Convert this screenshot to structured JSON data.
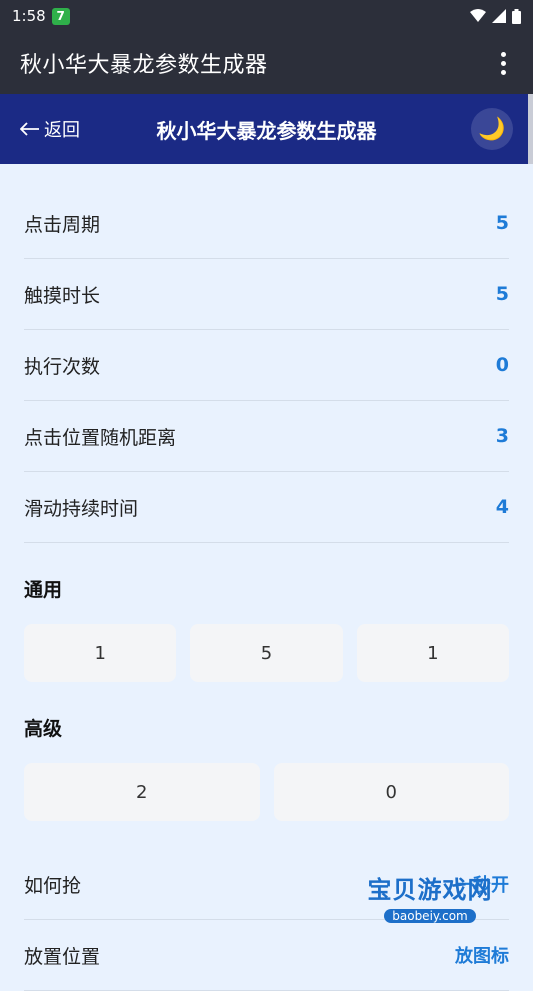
{
  "status_bar": {
    "time": "1:58",
    "notification_badge": "7"
  },
  "app_bar": {
    "title": "秋小华大暴龙参数生成器"
  },
  "page_header": {
    "back_label": "返回",
    "title": "秋小华大暴龙参数生成器",
    "theme_icon": "moon-icon"
  },
  "params": [
    {
      "label": "点击周期",
      "value": "5"
    },
    {
      "label": "触摸时长",
      "value": "5"
    },
    {
      "label": "执行次数",
      "value": "0"
    },
    {
      "label": "点击位置随机距离",
      "value": "3"
    },
    {
      "label": "滑动持续时间",
      "value": "4"
    }
  ],
  "general": {
    "title": "通用",
    "buttons": [
      "1",
      "5",
      "1"
    ]
  },
  "advanced": {
    "title": "高级",
    "buttons": [
      "2",
      "0"
    ]
  },
  "extra_rows": [
    {
      "label": "如何抢",
      "value": "一秒开"
    },
    {
      "label": "放置位置",
      "value": "放图标"
    }
  ],
  "watermark": {
    "main": "宝贝游戏网",
    "sub": "baobeiy.com"
  },
  "colors": {
    "appbar": "#2c2f3a",
    "header": "#1b2a85",
    "accent": "#1e7bd7",
    "background": "#e9f2fe"
  }
}
